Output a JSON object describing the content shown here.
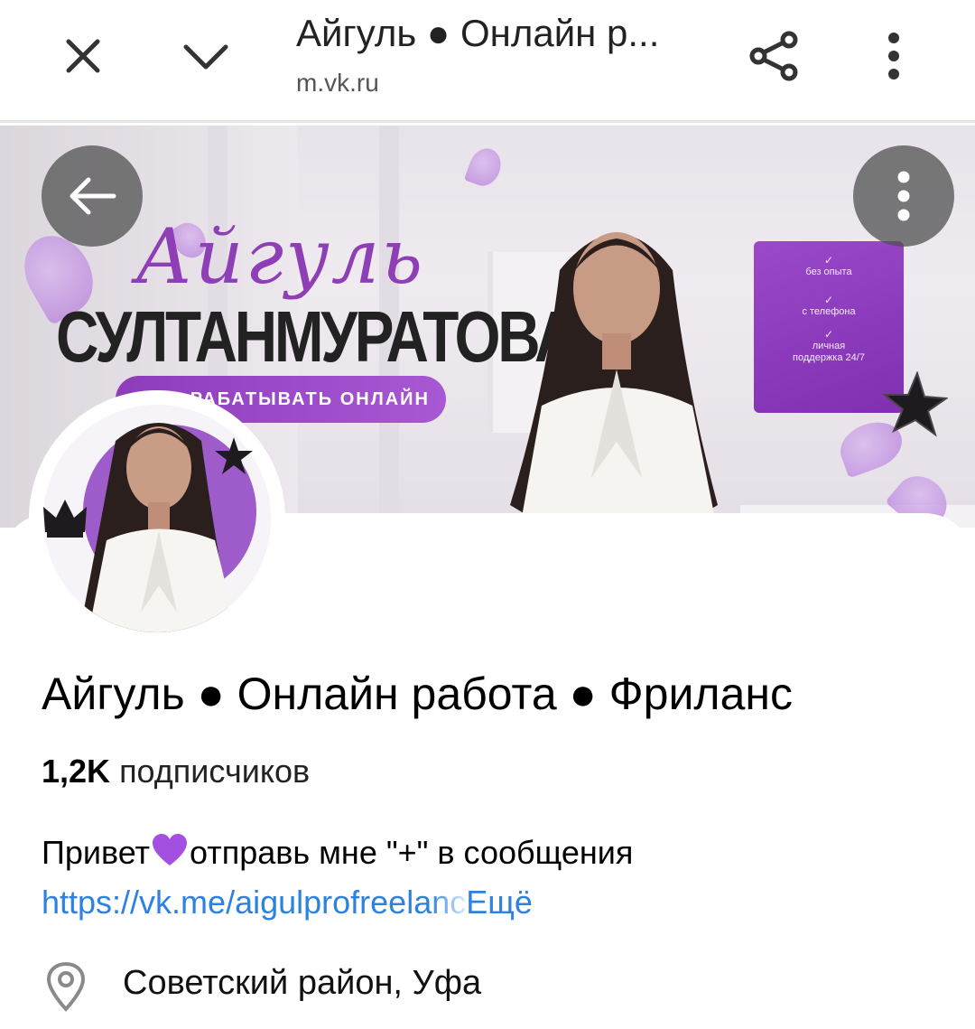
{
  "browser": {
    "title": "Айгуль ● Онлайн р...",
    "url": "m.vk.ru",
    "close_icon": "close-icon",
    "chevron_icon": "chevron-down-icon",
    "share_icon": "share-icon",
    "more_icon": "more-vertical-icon"
  },
  "cover": {
    "script_name": "Айгуль",
    "surname": "СУЛТАНМУРАТОВА",
    "pill_text": "РАБАТЫВАТЬ ОНЛАЙН",
    "card_items": [
      {
        "check": "✓",
        "line1": "без опыта",
        "line2": ""
      },
      {
        "check": "✓",
        "line1": "с телефона",
        "line2": ""
      },
      {
        "check": "✓",
        "line1": "личная",
        "line2": "поддержка 24/7"
      }
    ],
    "back_icon": "arrow-left-icon",
    "menu_icon": "more-vertical-icon",
    "accent_color": "#8e3fb5"
  },
  "profile": {
    "name": "Айгуль ● Онлайн работа ● Фриланс",
    "subscribers_count": "1,2K",
    "subscribers_label": "подписчиков",
    "status_before": "Привет",
    "status_after": "отправь мне \"+\" в сообщения",
    "link_visible": "https://vk.me/aigulprofree",
    "link_faded": "lanc",
    "more_label": "Ещё",
    "location": "Советский район, Уфа",
    "link_color": "#2d81e0"
  }
}
